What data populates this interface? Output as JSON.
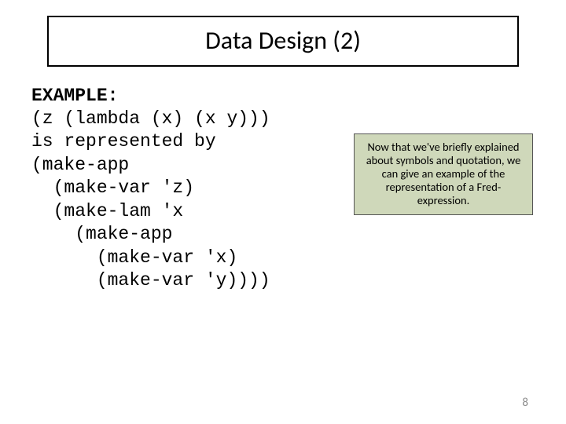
{
  "slide": {
    "title": "Data Design (2)",
    "example_label": "EXAMPLE:",
    "code": "(z (lambda (x) (x y)))\nis represented by\n(make-app\n  (make-var 'z)\n  (make-lam 'x\n    (make-app\n      (make-var 'x)\n      (make-var 'y))))",
    "note": "Now that we've briefly explained about symbols and quotation, we can give an example of the representation of a Fred-expression.",
    "page_number": "8"
  }
}
